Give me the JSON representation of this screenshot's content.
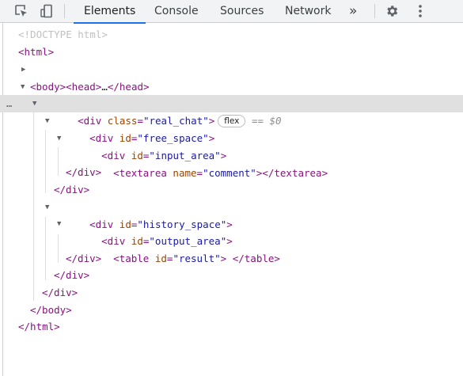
{
  "toolbar": {
    "tabs": [
      {
        "label": "Elements",
        "active": true
      },
      {
        "label": "Console",
        "active": false
      },
      {
        "label": "Sources",
        "active": false
      },
      {
        "label": "Network",
        "active": false
      }
    ],
    "more_tabs": "»",
    "icons": [
      "inspect-element-icon",
      "device-toolbar-icon",
      "settings-gear-icon",
      "more-options-kebab-icon"
    ]
  },
  "colors": {
    "tag": "#881280",
    "attr_name": "#994500",
    "attr_value": "#1a1aa6",
    "accent": "#1a73e8",
    "selected_row": "#e0e0e0"
  },
  "dom": {
    "doctype": "<!DOCTYPE html>",
    "html_open": "<html>",
    "head": {
      "open": "<head>",
      "ellipsis": "…",
      "close": "</head>"
    },
    "body_open": "<body>",
    "real_chat": {
      "open_start": "<div",
      "attr": "class",
      "value": "\"real_chat\"",
      "open_end": ">",
      "badge": "flex",
      "console_ref": "== $0",
      "gutter": "…"
    },
    "free_space_open": {
      "tag": "<div",
      "attr": "id",
      "value": "\"free_space\"",
      "end": ">"
    },
    "input_area_open": {
      "tag": "<div",
      "attr": "id",
      "value": "\"input_area\"",
      "end": ">"
    },
    "textarea": {
      "tag": "<textarea",
      "attr": "name",
      "value": "\"comment\"",
      "end": "></textarea>"
    },
    "input_area_close": "</div>",
    "free_space_close": "</div>",
    "history_space_open": {
      "tag": "<div",
      "attr": "id",
      "value": "\"history_space\"",
      "end": ">"
    },
    "output_area_open": {
      "tag": "<div",
      "attr": "id",
      "value": "\"output_area\"",
      "end": ">"
    },
    "table": {
      "tag": "<table",
      "attr": "id",
      "value": "\"result\"",
      "end": ">",
      "inner": " ",
      "close": "</table>"
    },
    "output_area_close": "</div>",
    "history_space_close": "</div>",
    "real_chat_close": "</div>",
    "body_close": "</body>",
    "html_close": "</html>"
  }
}
